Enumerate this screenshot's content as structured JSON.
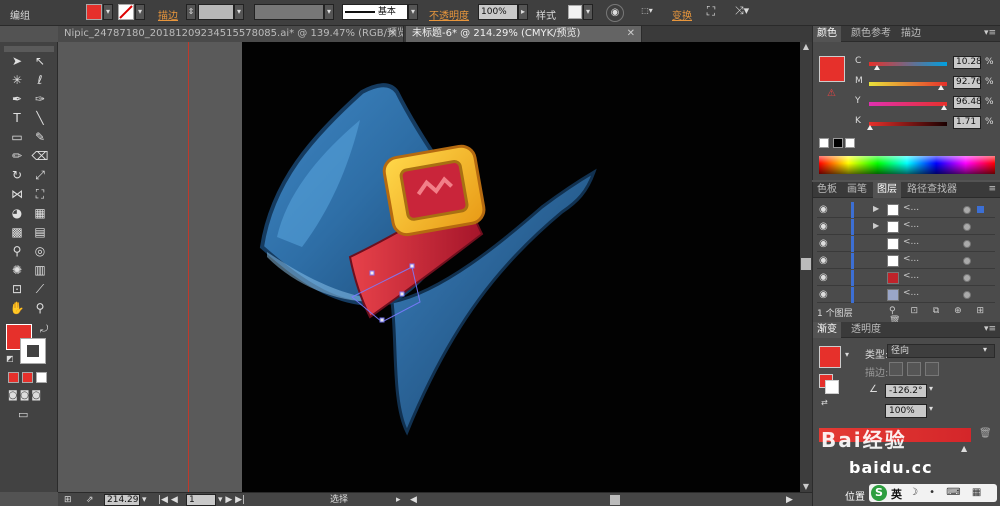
{
  "control_bar": {
    "group_label": "编组",
    "stroke_label": "描边",
    "stroke_weight_value": "",
    "brush_value": "",
    "profile_label": "基本",
    "opacity_label": "不透明度",
    "opacity_value": "100%",
    "style_label": "样式",
    "transform_label": "变换",
    "fill_color": "#e6302b"
  },
  "tabs": [
    {
      "label": "Nipic_24787180_20181209234515578085.ai* @ 139.47% (RGB/预览)",
      "active": false
    },
    {
      "label": "未标题-6* @ 214.29% (CMYK/预览)",
      "active": true
    }
  ],
  "color_panel": {
    "tabs": [
      "颜色",
      "颜色参考",
      "描边"
    ],
    "fill_color": "#e6302b",
    "channels": [
      {
        "name": "C",
        "value": "10.28",
        "knob": 0.1028,
        "gradient": "linear-gradient(to right,#e6302b,#00a0e0)"
      },
      {
        "name": "M",
        "value": "92.76",
        "knob": 0.9276,
        "gradient": "linear-gradient(to right,#e8e23a,#e6302b)"
      },
      {
        "name": "Y",
        "value": "96.48",
        "knob": 0.9648,
        "gradient": "linear-gradient(to right,#e030b0,#e6302b)"
      },
      {
        "name": "K",
        "value": "1.71",
        "knob": 0.0171,
        "gradient": "linear-gradient(to right,#e6302b,#1a0000)"
      }
    ],
    "pct": "%"
  },
  "layers_panel": {
    "tabs": [
      "色板",
      "画笔",
      "图层",
      "路径查找器"
    ],
    "rows": [
      {
        "name": "<...",
        "arrow": "▶",
        "thumb": "#ffffff",
        "selected": true
      },
      {
        "name": "<...",
        "arrow": "▶",
        "thumb": "#ffffff",
        "selected": false
      },
      {
        "name": "<...",
        "arrow": "",
        "thumb": "#ffffff",
        "selected": false
      },
      {
        "name": "<...",
        "arrow": "",
        "thumb": "#ffffff",
        "selected": false
      },
      {
        "name": "<...",
        "arrow": "",
        "thumb": "#c0232a",
        "selected": false
      },
      {
        "name": "<...",
        "arrow": "",
        "thumb": "#9aa6c8",
        "selected": false
      }
    ],
    "footer": "1 个图层"
  },
  "gradient_panel": {
    "tabs": [
      "渐变",
      "透明度"
    ],
    "type_label": "类型:",
    "type_value": "径向",
    "stroke_label": "描边:",
    "angle_value": "-126.2°",
    "ratio_value": "100%",
    "watermark": "Bai经验",
    "baidu_text": "baidu.cc",
    "position_label": "位置"
  },
  "ime": {
    "logo": "S",
    "lang": "英",
    "icons": "☽ • ⌨ ▦"
  },
  "status_bar": {
    "zoom_value": "214.29",
    "page_value": "1",
    "mode_label": "选择"
  },
  "tools": [
    {
      "name": "selection-tool-icon",
      "glyph": "➤"
    },
    {
      "name": "direct-selection-tool-icon",
      "glyph": "↖"
    },
    {
      "name": "magic-wand-icon",
      "glyph": "✳"
    },
    {
      "name": "lasso-icon",
      "glyph": "ℓ"
    },
    {
      "name": "pen-tool-icon",
      "glyph": "✒"
    },
    {
      "name": "curvature-icon",
      "glyph": "✑"
    },
    {
      "name": "type-tool-icon",
      "glyph": "T"
    },
    {
      "name": "line-tool-icon",
      "glyph": "╲"
    },
    {
      "name": "rectangle-tool-icon",
      "glyph": "▭"
    },
    {
      "name": "paintbrush-icon",
      "glyph": "✎"
    },
    {
      "name": "pencil-icon",
      "glyph": "✏"
    },
    {
      "name": "eraser-icon",
      "glyph": "⌫"
    },
    {
      "name": "rotate-icon",
      "glyph": "↻"
    },
    {
      "name": "scale-icon",
      "glyph": "⤢"
    },
    {
      "name": "width-tool-icon",
      "glyph": "⋈"
    },
    {
      "name": "free-transform-icon",
      "glyph": "⛶"
    },
    {
      "name": "shape-builder-icon",
      "glyph": "◕"
    },
    {
      "name": "perspective-grid-icon",
      "glyph": "▦"
    },
    {
      "name": "mesh-tool-icon",
      "glyph": "▩"
    },
    {
      "name": "gradient-tool-icon",
      "glyph": "▤"
    },
    {
      "name": "eyedropper-icon",
      "glyph": "⚲"
    },
    {
      "name": "blend-tool-icon",
      "glyph": "◎"
    },
    {
      "name": "symbol-sprayer-icon",
      "glyph": "✺"
    },
    {
      "name": "column-graph-icon",
      "glyph": "▥"
    },
    {
      "name": "artboard-tool-icon",
      "glyph": "⊡"
    },
    {
      "name": "slice-tool-icon",
      "glyph": "⟋"
    },
    {
      "name": "hand-tool-icon",
      "glyph": "✋"
    },
    {
      "name": "zoom-tool-icon",
      "glyph": "⚲"
    }
  ]
}
